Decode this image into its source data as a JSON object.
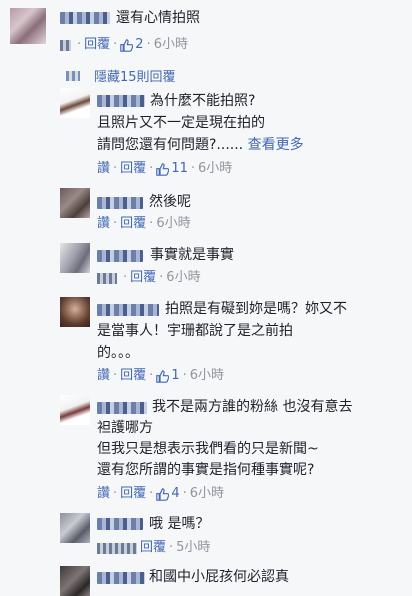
{
  "comments": [
    {
      "text_lines": [
        "還有心情拍照"
      ],
      "action": "回覆",
      "likes": "2",
      "time": "6小時"
    },
    {
      "hidden_replies": "隱藏15則回覆"
    },
    {
      "text_lines": [
        "為什麼不能拍照?",
        "且照片又不一定是現在拍的",
        "請問您還有何問題?......"
      ],
      "see_more": "查看更多",
      "like_label": "讚",
      "action": "回覆",
      "likes": "11",
      "time": "6小時"
    },
    {
      "text_lines": [
        "然後呢"
      ],
      "like_label": "讚",
      "action": "回覆",
      "time": "6小時"
    },
    {
      "text_lines": [
        "事實就是事實"
      ],
      "action": "回覆",
      "time": "6小時"
    },
    {
      "text_lines": [
        "拍照是有礙到妳是嗎？妳又不",
        "是當事人！宇珊都說了是之前拍",
        "的。。。"
      ],
      "like_label": "讚",
      "action": "回覆",
      "likes": "1",
      "time": "6小時"
    },
    {
      "text_lines": [
        "我不是兩方誰的粉絲 也沒有意去",
        "袒護哪方",
        "但我只是想表示我們看的只是新聞~",
        "還有您所謂的事實是指何種事實呢?"
      ],
      "like_label": "讚",
      "action": "回覆",
      "likes": "4",
      "time": "6小時"
    },
    {
      "text_lines": [
        "哦 是嗎？"
      ],
      "action": "回覆",
      "time": "5小時"
    },
    {
      "text_lines": [
        "和國中小屁孩何必認真"
      ]
    }
  ]
}
